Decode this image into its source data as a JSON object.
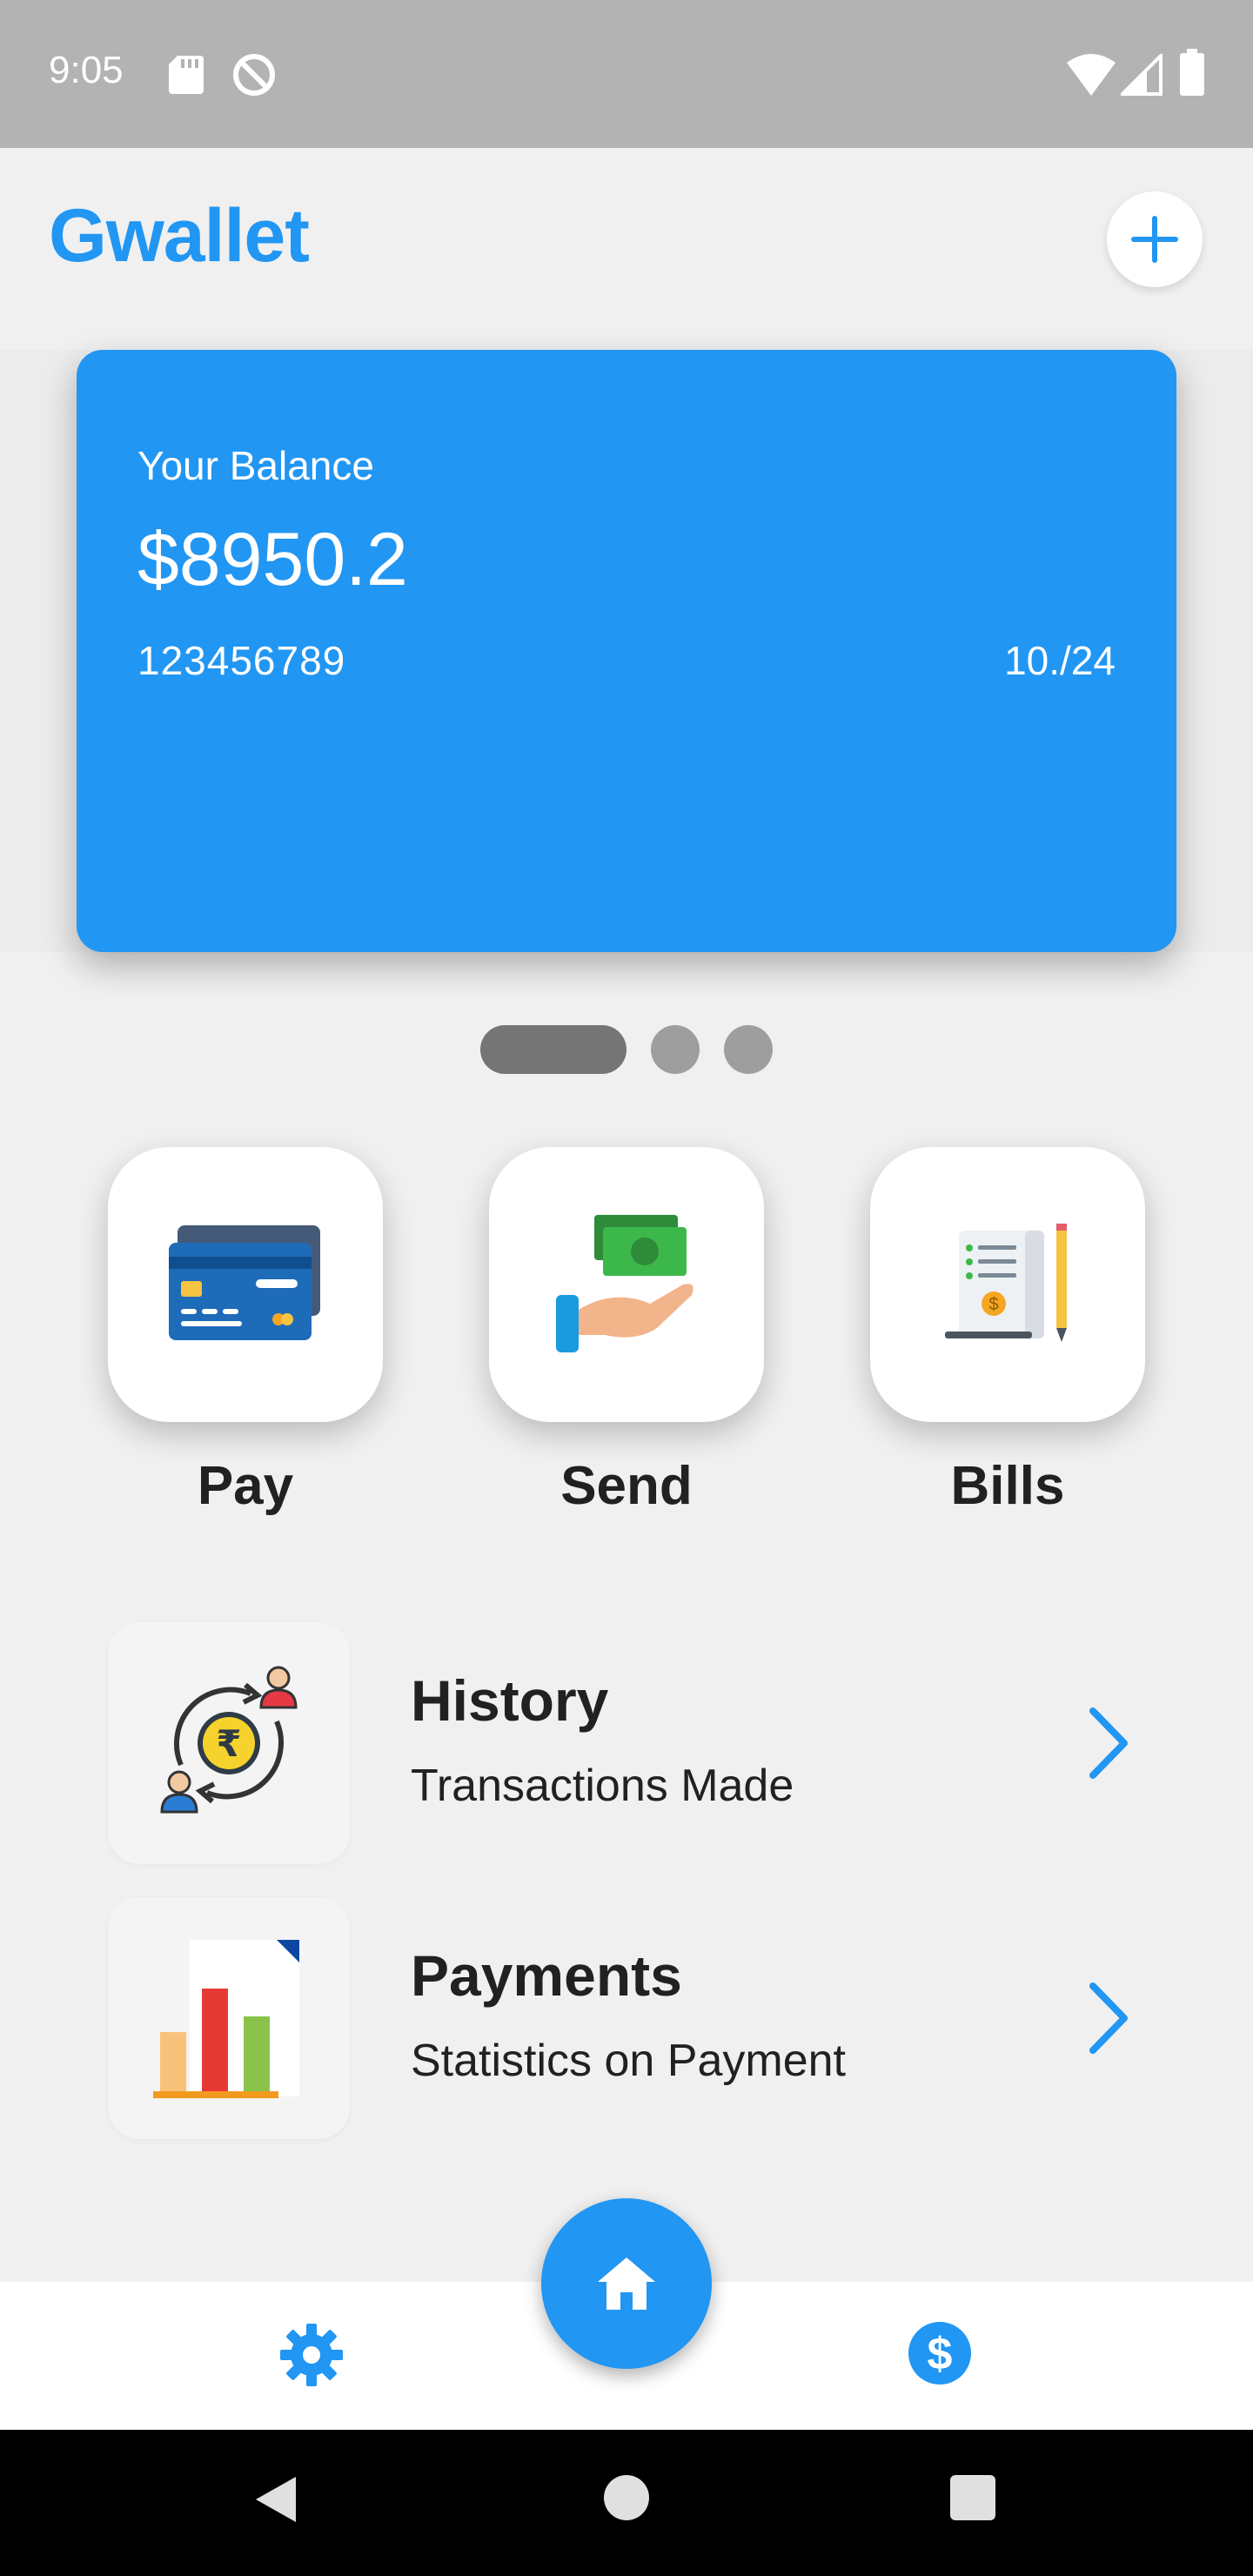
{
  "status_bar": {
    "time": "9:05",
    "icons": [
      "sd-card-icon",
      "sync-icon",
      "wifi-icon",
      "signal-icon",
      "battery-icon"
    ]
  },
  "app_bar": {
    "title": "Gwallet",
    "add_icon": "plus-icon"
  },
  "balance_card": {
    "label": "Your Balance",
    "amount": "$8950.2",
    "card_number": "123456789",
    "expiry": "10./24",
    "color": "#2196f3"
  },
  "carousel": {
    "page_count": 3,
    "active_index": 0
  },
  "quick_actions": [
    {
      "label": "Pay",
      "icon": "credit-card-icon"
    },
    {
      "label": "Send",
      "icon": "money-hand-icon"
    },
    {
      "label": "Bills",
      "icon": "bill-receipt-icon"
    }
  ],
  "list": [
    {
      "title": "History",
      "subtitle": "Transactions Made",
      "icon": "rupee-exchange-icon"
    },
    {
      "title": "Payments",
      "subtitle": "Statistics on Payment",
      "icon": "bar-chart-document-icon"
    }
  ],
  "bottom_nav": {
    "left_icon": "settings-gear-icon",
    "center_icon": "home-icon",
    "right_icon": "dollar-circle-icon"
  },
  "colors": {
    "accent": "#2196f3",
    "background": "#f0f0f0",
    "status_bar": "#b3b3b3"
  }
}
